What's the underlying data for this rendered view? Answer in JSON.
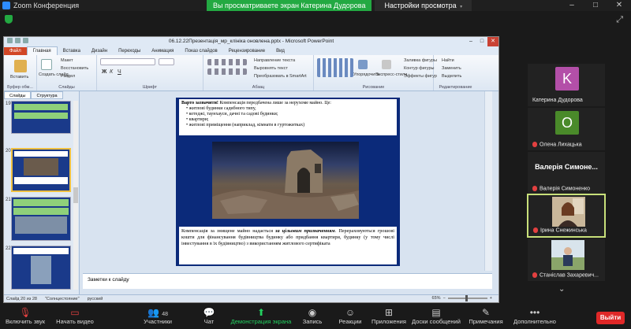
{
  "zoom": {
    "window_title": "Zoom Конференция",
    "share_banner": "Вы просматриваете экран Катерина Дудорова",
    "view_settings": "Настройки просмотра",
    "window_controls": [
      "–",
      "□",
      "✕"
    ]
  },
  "ppt": {
    "title": "06.12.22Презентація_мр_клініка оновлена.pptx - Microsoft PowerPoint",
    "tabs": [
      "Файл",
      "Главная",
      "Вставка",
      "Дизайн",
      "Переходы",
      "Анимация",
      "Показ слайдов",
      "Рецензирование",
      "Вид"
    ],
    "active_tab": "Главная",
    "ribbon": {
      "paste": "Вставить",
      "create_slide": "Создать слайд",
      "layout": "Макет",
      "restore": "Восстановить",
      "section": "Раздел",
      "direction": "Направление текста",
      "align": "Выровнять текст",
      "smartart": "Преобразовать в SmartArt",
      "arrange": "Упорядочить",
      "quick_styles": "Экспресс-стили",
      "shape_fill": "Заливка фигуры",
      "shape_outline": "Контур фигуры",
      "shape_effects": "Эффекты фигур",
      "find": "Найти",
      "replace": "Заменить",
      "select": "Выделить",
      "groups": {
        "clipboard": "Буфер обм...",
        "slides": "Слайды",
        "font": "Шрифт",
        "paragraph": "Абзац",
        "drawing": "Рисование",
        "editing": "Редактирование"
      }
    },
    "panel_tabs": [
      "Слайды",
      "Структура"
    ],
    "thumb_numbers": [
      "19",
      "20",
      "21",
      "22"
    ],
    "slide": {
      "heading_bold": "Варто зазначити!",
      "heading_rest": " Компенсація передбачена лише за нерухоме майно. Це:",
      "bullets": [
        "житлові будинки садибного типу,",
        "котеджі, таунхауси, дачні та садові будинки;",
        "квартири;",
        "житлові приміщення (наприклад, кімнати в гуртожитках)"
      ],
      "para_start": "Компенсація за знищене майно надається ",
      "para_emph": "за цільовим призначенням",
      "para_end": ". Перераховуються грошові кошти для фінансування будівництва будинку або придбання квартири, будинку (у тому числі інвестування в їх будівництво) з використанням житлового сертифіката"
    },
    "notes_placeholder": "Заметки к слайду",
    "status": {
      "slide_info": "Слайд 20 из 28",
      "theme": "\"Солнцестояние\"",
      "language": "русский",
      "zoom": "65%"
    }
  },
  "participants": [
    {
      "name": "Катерина Дудорова",
      "initial": "K",
      "color": "#b34fa8",
      "muted": false
    },
    {
      "name": "Олена Лихацька",
      "initial": "O",
      "color": "#4a8a2a",
      "muted": true
    },
    {
      "name": "Валерія Симоненко",
      "big_label": "Валерія Симоне...",
      "muted": true
    },
    {
      "name": "Ірина Снежинська",
      "muted": true,
      "active": true
    },
    {
      "name": "Станіслав Захаревич...",
      "muted": true
    }
  ],
  "toolbar": {
    "unmute": "Включить звук",
    "video": "Начать видео",
    "participants": "Участники",
    "participants_count": "48",
    "chat": "Чат",
    "share": "Демонстрация экрана",
    "record": "Запись",
    "reactions": "Реакции",
    "apps": "Приложения",
    "whiteboards": "Доски сообщений",
    "notes": "Примечания",
    "more": "Дополнительно",
    "leave": "Выйти"
  }
}
